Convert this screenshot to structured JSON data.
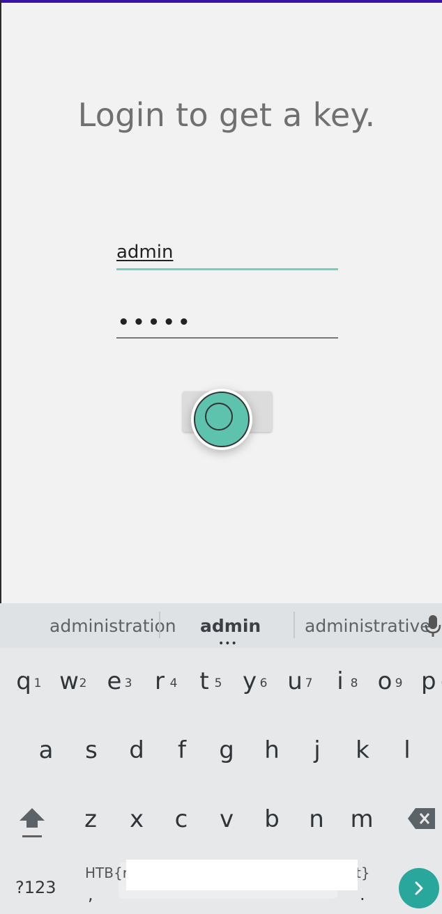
{
  "screen": {
    "title": "Login to get a key."
  },
  "form": {
    "username_value": "admin",
    "password_masked": "•••••",
    "login_label": "LOGIN"
  },
  "keyboard": {
    "suggestions": [
      "administration",
      "admin",
      "administrative"
    ],
    "more_dots": "•••",
    "row1": [
      {
        "letter": "q",
        "num": "1"
      },
      {
        "letter": "w",
        "num": "2"
      },
      {
        "letter": "e",
        "num": "3"
      },
      {
        "letter": "r",
        "num": "4"
      },
      {
        "letter": "t",
        "num": "5"
      },
      {
        "letter": "y",
        "num": "6"
      },
      {
        "letter": "u",
        "num": "7"
      },
      {
        "letter": "i",
        "num": "8"
      },
      {
        "letter": "o",
        "num": "9"
      },
      {
        "letter": "p",
        "num": "0"
      }
    ],
    "row2": [
      "a",
      "s",
      "d",
      "f",
      "g",
      "h",
      "j",
      "k",
      "l"
    ],
    "row3": [
      "z",
      "x",
      "c",
      "v",
      "b",
      "n",
      "m"
    ],
    "symbols_label": "?123",
    "comma": ",",
    "period": ".",
    "clipboard_prefix": "HTB{r",
    "clipboard_suffix": "t}",
    "icons": [
      "mic-icon",
      "shift-icon",
      "delete-icon",
      "enter-arrow-icon"
    ],
    "colors": {
      "accent": "#2aa79c",
      "status_bar": "#3a12a8",
      "field_focus": "#6fd0c0"
    }
  }
}
